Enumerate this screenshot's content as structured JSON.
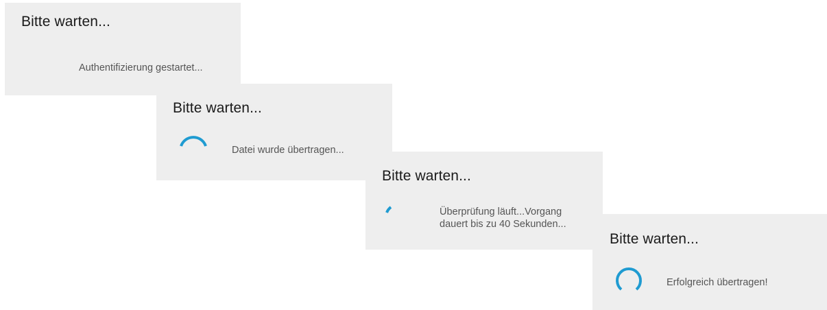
{
  "accent_color": "#1f9bd1",
  "dialogs": [
    {
      "title": "Bitte warten...",
      "message": "Authentifizierung gestartet...",
      "spinner": "none"
    },
    {
      "title": "Bitte warten...",
      "message": "Datei wurde übertragen...",
      "spinner": "progress-spinner-icon"
    },
    {
      "title": "Bitte warten...",
      "message_lines": [
        "Überprüfung läuft...Vorgang",
        "dauert bis zu 40 Sekunden..."
      ],
      "spinner": "progress-spinner-icon"
    },
    {
      "title": "Bitte warten...",
      "message": "Erfolgreich übertragen!",
      "spinner": "progress-spinner-icon"
    }
  ]
}
